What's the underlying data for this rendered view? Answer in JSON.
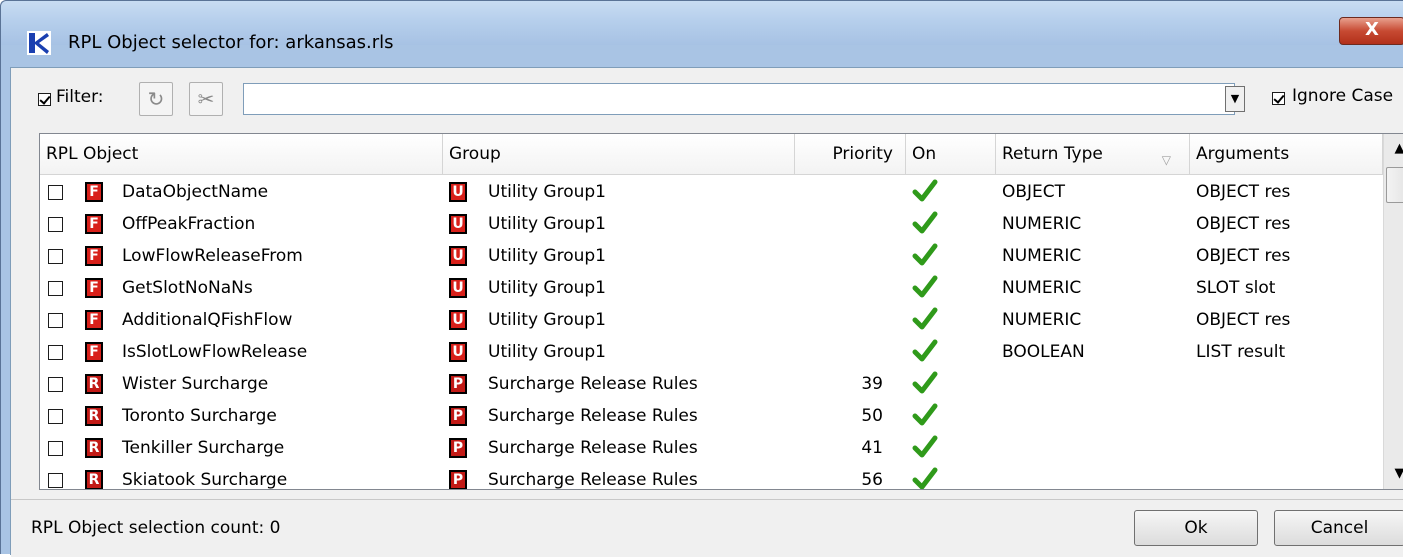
{
  "window": {
    "title": "RPL Object selector for: arkansas.rls",
    "close_label": "X"
  },
  "filter": {
    "checked": true,
    "label": "Filter:",
    "value": "",
    "ignore_case_label": "Ignore Case",
    "ignore_case_checked": true
  },
  "table": {
    "columns": [
      "RPL Object",
      "Group",
      "Priority",
      "On",
      "Return Type",
      "Arguments"
    ],
    "rows": [
      {
        "type": "F",
        "name": "DataObjectName",
        "group_type": "U",
        "group": "Utility Group1",
        "priority": "",
        "on": true,
        "return_type": "OBJECT",
        "arguments": "OBJECT res"
      },
      {
        "type": "F",
        "name": "OffPeakFraction",
        "group_type": "U",
        "group": "Utility Group1",
        "priority": "",
        "on": true,
        "return_type": "NUMERIC",
        "arguments": "OBJECT res"
      },
      {
        "type": "F",
        "name": "LowFlowReleaseFrom",
        "group_type": "U",
        "group": "Utility Group1",
        "priority": "",
        "on": true,
        "return_type": "NUMERIC",
        "arguments": "OBJECT res"
      },
      {
        "type": "F",
        "name": "GetSlotNoNaNs",
        "group_type": "U",
        "group": "Utility Group1",
        "priority": "",
        "on": true,
        "return_type": "NUMERIC",
        "arguments": "SLOT slot"
      },
      {
        "type": "F",
        "name": "AdditionalQFishFlow",
        "group_type": "U",
        "group": "Utility Group1",
        "priority": "",
        "on": true,
        "return_type": "NUMERIC",
        "arguments": "OBJECT res"
      },
      {
        "type": "F",
        "name": "IsSlotLowFlowRelease",
        "group_type": "U",
        "group": "Utility Group1",
        "priority": "",
        "on": true,
        "return_type": "BOOLEAN",
        "arguments": "LIST result"
      },
      {
        "type": "R",
        "name": "Wister Surcharge",
        "group_type": "P",
        "group": "Surcharge Release Rules",
        "priority": "39",
        "on": true,
        "return_type": "",
        "arguments": ""
      },
      {
        "type": "R",
        "name": "Toronto Surcharge",
        "group_type": "P",
        "group": "Surcharge Release Rules",
        "priority": "50",
        "on": true,
        "return_type": "",
        "arguments": ""
      },
      {
        "type": "R",
        "name": "Tenkiller Surcharge",
        "group_type": "P",
        "group": "Surcharge Release Rules",
        "priority": "41",
        "on": true,
        "return_type": "",
        "arguments": ""
      },
      {
        "type": "R",
        "name": "Skiatook Surcharge",
        "group_type": "P",
        "group": "Surcharge Release Rules",
        "priority": "56",
        "on": true,
        "return_type": "",
        "arguments": ""
      }
    ]
  },
  "status": {
    "text": "RPL Object selection count: 0",
    "ok_label": "Ok",
    "cancel_label": "Cancel"
  },
  "colors": {
    "accent_red": "#d8201a",
    "check_green": "#2f9a1a",
    "titlebar": "#b6cfec"
  }
}
